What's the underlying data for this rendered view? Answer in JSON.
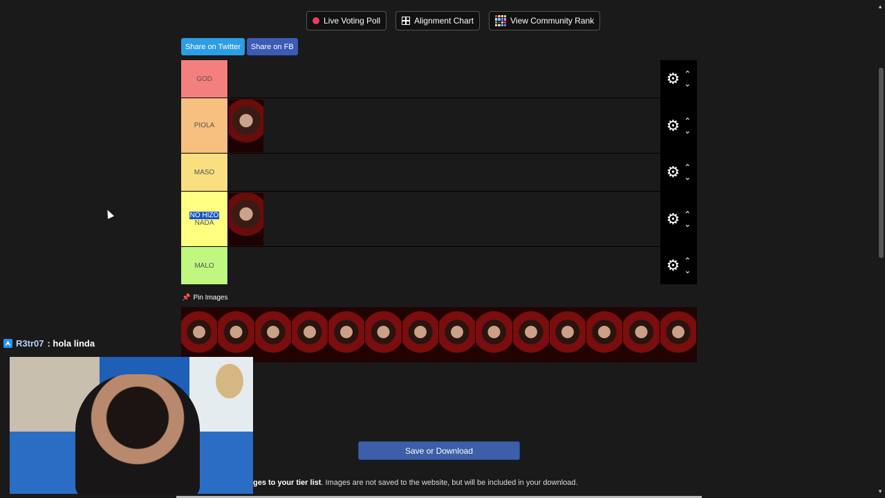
{
  "topbar": {
    "live_poll": "Live Voting Poll",
    "alignment": "Alignment Chart",
    "community": "View Community Rank"
  },
  "share": {
    "twitter": "Share on Twitter",
    "facebook": "Share on FB"
  },
  "tiers": [
    {
      "label": "GOD",
      "color": "#f47f7f",
      "items": 0
    },
    {
      "label": "PIOLA",
      "color": "#f7bf80",
      "items": 1
    },
    {
      "label": "MASO",
      "color": "#f9df80",
      "items": 0
    },
    {
      "label_selected": "NO HIZO",
      "label_rest": "NADA",
      "color": "#fefe80",
      "items": 1
    },
    {
      "label": "MALO",
      "color": "#bff77f",
      "items": 0
    }
  ],
  "pin_label": "Pin Images",
  "pool_count": 14,
  "chat": {
    "user": "R3tr07",
    "message": ": hola linda"
  },
  "save_label": "Save or Download",
  "note": {
    "bold": "ges to your tier list",
    "rest": ". Images are not saved to the website, but will be included in your download."
  },
  "icons": {
    "live": "record-dot-icon",
    "alignment": "grid-icon",
    "community": "rank-grid-icon",
    "settings": "gear-icon",
    "move_up": "chevron-up-icon",
    "move_down": "chevron-down-icon",
    "pin": "pin-icon"
  }
}
